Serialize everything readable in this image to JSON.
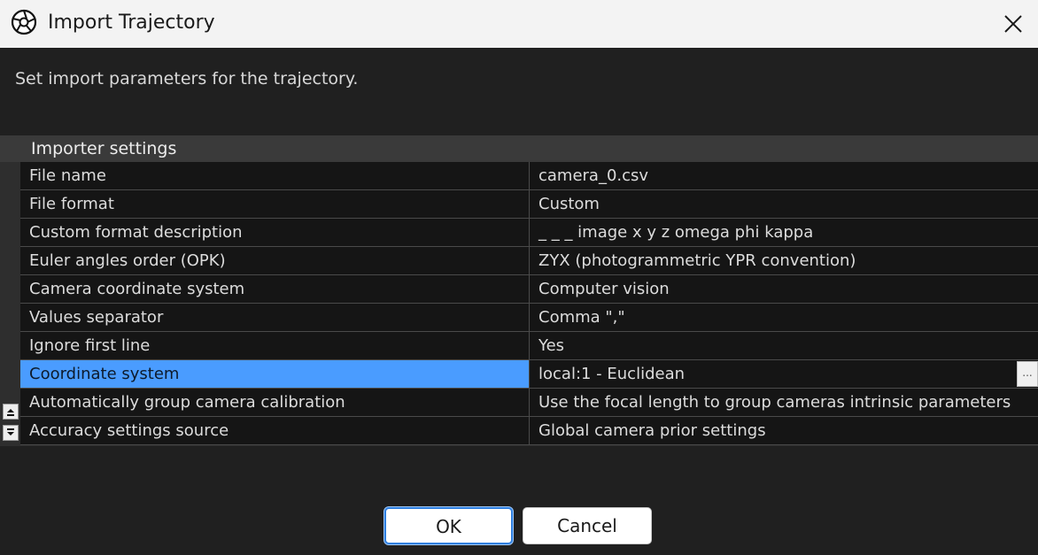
{
  "window": {
    "title": "Import Trajectory",
    "close_symbol": "✕"
  },
  "description": "Set import parameters for the trajectory.",
  "group": {
    "label": "Importer settings"
  },
  "properties": [
    {
      "name": "File name",
      "value": "camera_0.csv"
    },
    {
      "name": "File format",
      "value": "Custom"
    },
    {
      "name": "Custom format description",
      "value": "_ _ _ image x y z omega phi kappa"
    },
    {
      "name": "Euler angles order (OPK)",
      "value": "ZYX (photogrammetric YPR convention)"
    },
    {
      "name": "Camera coordinate system",
      "value": "Computer vision"
    },
    {
      "name": "Values separator",
      "value": "Comma \",\""
    },
    {
      "name": "Ignore first line",
      "value": "Yes"
    },
    {
      "name": "Coordinate system",
      "value": "local:1 - Euclidean",
      "selected": true,
      "ellipsis": "..."
    },
    {
      "name": "Automatically group camera calibration",
      "value": "Use the focal length to group cameras intrinsic parameters"
    },
    {
      "name": "Accuracy settings source",
      "value": "Global camera prior settings"
    }
  ],
  "buttons": {
    "ok": "OK",
    "cancel": "Cancel"
  },
  "colors": {
    "selection": "#4a9cff",
    "background": "#202020",
    "accent_border": "#2f7fe0"
  },
  "icons": {
    "app": "aperture-icon",
    "close": "close-icon",
    "sort_up": "sort-up-icon",
    "sort_down": "sort-down-icon"
  }
}
